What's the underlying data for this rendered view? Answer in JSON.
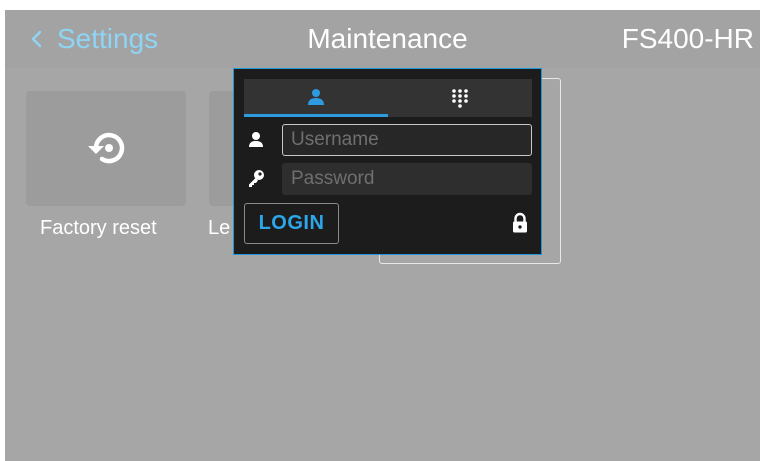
{
  "header": {
    "back_label": "Settings",
    "title": "Maintenance",
    "device_name": "FS400-HR"
  },
  "tiles": [
    {
      "label": "Factory reset",
      "icon": "restore-icon"
    },
    {
      "label": "Le",
      "icon": ""
    }
  ],
  "login": {
    "tabs": [
      {
        "icon": "user-icon",
        "active": true
      },
      {
        "icon": "keypad-icon",
        "active": false
      }
    ],
    "username_placeholder": "Username",
    "password_placeholder": "Password",
    "login_label": "LOGIN",
    "field_icons": [
      "user-icon",
      "key-icon"
    ],
    "lock_icon": "lock-icon"
  },
  "colors": {
    "accent": "#2e9be0",
    "back_link": "#8ed4f5",
    "screen_background": "#a6a6a6",
    "panel_background": "#1c1c1c"
  }
}
